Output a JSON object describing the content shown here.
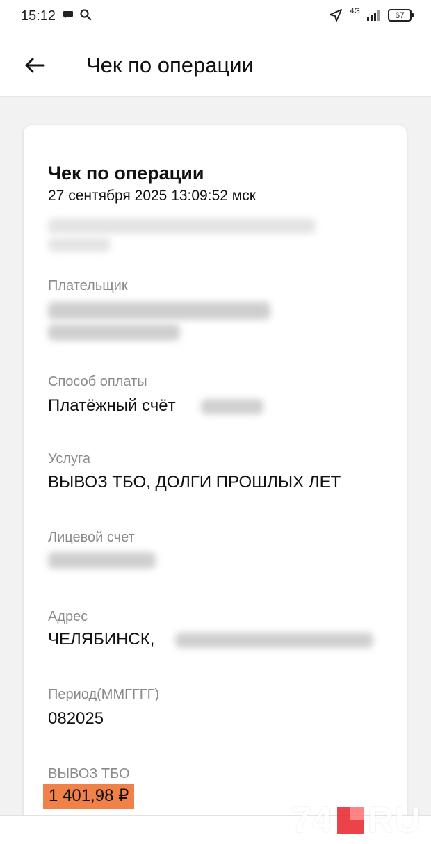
{
  "status_bar": {
    "time": "15:12",
    "network": "4G",
    "battery": "67"
  },
  "header": {
    "title": "Чек по операции"
  },
  "receipt": {
    "title": "Чек по операции",
    "datetime": "27 сентября 2025 13:09:52 мск",
    "payer_label": "Плательщик",
    "payment_method_label": "Способ оплаты",
    "payment_method_value": "Платёжный счёт",
    "service_label": "Услуга",
    "service_value": "ВЫВОЗ ТБО, ДОЛГИ ПРОШЛЫХ ЛЕТ",
    "account_label": "Лицевой счет",
    "address_label": "Адрес",
    "address_value": "ЧЕЛЯБИНСК,",
    "period_label": "Период(ММГГГГ)",
    "period_value": "082025",
    "amount_label": "ВЫВОЗ ТБО",
    "amount_value": "1 401,98 ₽"
  },
  "watermark": {
    "left": "74",
    "right": "RU"
  },
  "colors": {
    "amount_highlight": "#f08148",
    "watermark_red": "#e8232a"
  }
}
